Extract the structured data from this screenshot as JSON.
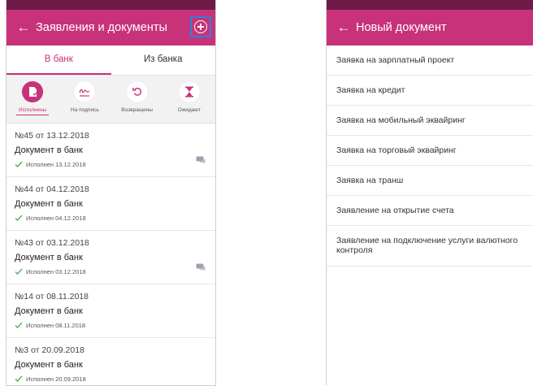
{
  "left": {
    "title": "Заявления и документы",
    "tabs": [
      {
        "label": "В банк",
        "active": true
      },
      {
        "label": "Из банка",
        "active": false
      }
    ],
    "filters": [
      {
        "label": "Исполнены",
        "icon": "doc-check-icon",
        "active": true
      },
      {
        "label": "На подпись",
        "icon": "signature-icon",
        "active": false
      },
      {
        "label": "Возвращены",
        "icon": "return-icon",
        "active": false
      },
      {
        "label": "Ожидают",
        "icon": "hourglass-icon",
        "active": false
      }
    ],
    "documents": [
      {
        "number": "№45 от 13.12.2018",
        "title": "Документ в банк",
        "status": "Исполнен 13.12.2018",
        "chat": true
      },
      {
        "number": "№44 от 04.12.2018",
        "title": "Документ в банк",
        "status": "Исполнен 04.12.2018",
        "chat": false
      },
      {
        "number": "№43 от 03.12.2018",
        "title": "Документ в банк",
        "status": "Исполнен 03.12.2018",
        "chat": true
      },
      {
        "number": "№14 от 08.11.2018",
        "title": "Документ в банк",
        "status": "Исполнен 08.11.2018",
        "chat": false
      },
      {
        "number": "№3 от 20.09.2018",
        "title": "Документ в банк",
        "status": "Исполнен 20.09.2018",
        "chat": false
      }
    ]
  },
  "right": {
    "title": "Новый документ",
    "items": [
      "Заявка на зарплатный проект",
      "Заявка на кредит",
      "Заявка на мобильный эквайринг",
      "Заявка на торговый эквайринг",
      "Заявка на транш",
      "Заявление на открытие счета",
      "Заявление на подключение услуги валютного контроля"
    ]
  },
  "colors": {
    "accent": "#c8327a",
    "statusbar": "#6e1b47",
    "highlight": "#2f7fd6",
    "success": "#4caf50"
  }
}
